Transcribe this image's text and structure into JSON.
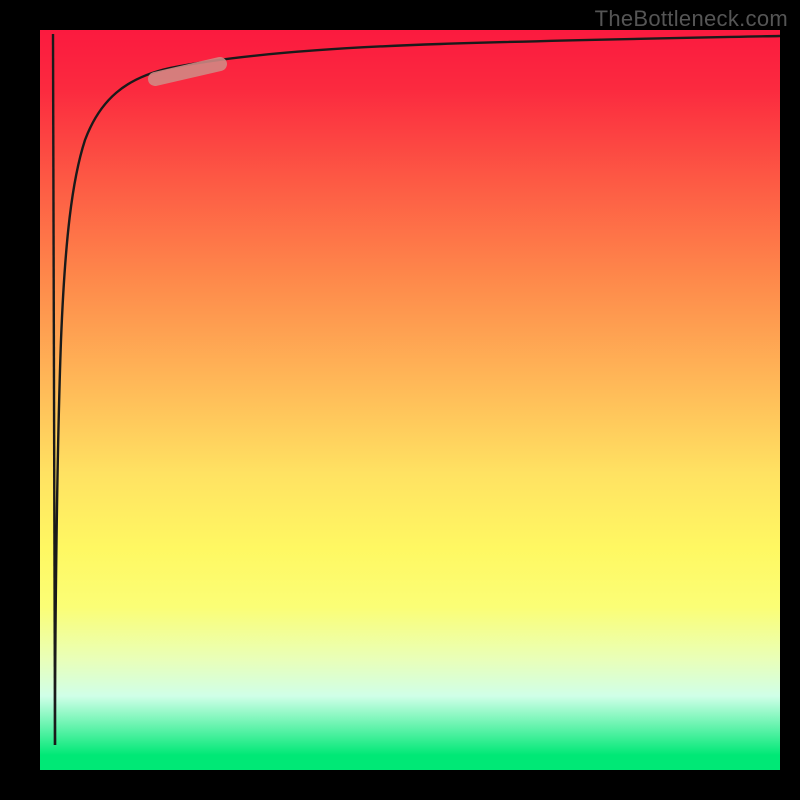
{
  "watermark": "TheBottleneck.com",
  "chart_data": {
    "type": "line",
    "title": "",
    "xlabel": "",
    "ylabel": "",
    "xlim": [
      0,
      100
    ],
    "ylim": [
      0,
      100
    ],
    "series": [
      {
        "name": "curve",
        "x": [
          2,
          2.3,
          2.8,
          3.5,
          4.5,
          6,
          8,
          11,
          15,
          20,
          28,
          40,
          55,
          70,
          85,
          100
        ],
        "y": [
          2,
          30,
          55,
          70,
          80,
          86,
          89.5,
          92,
          93.8,
          95,
          96,
          96.8,
          97.4,
          97.8,
          98.1,
          98.4
        ]
      }
    ],
    "highlight_range": {
      "x_start": 15,
      "x_end": 24,
      "y_start": 93.5,
      "y_end": 95.3
    },
    "background_gradient": {
      "top": "#fb1a3f",
      "upper_mid": "#fe8a4b",
      "mid": "#ffe262",
      "lower_mid": "#fbfe76",
      "bottom": "#00e876"
    }
  }
}
